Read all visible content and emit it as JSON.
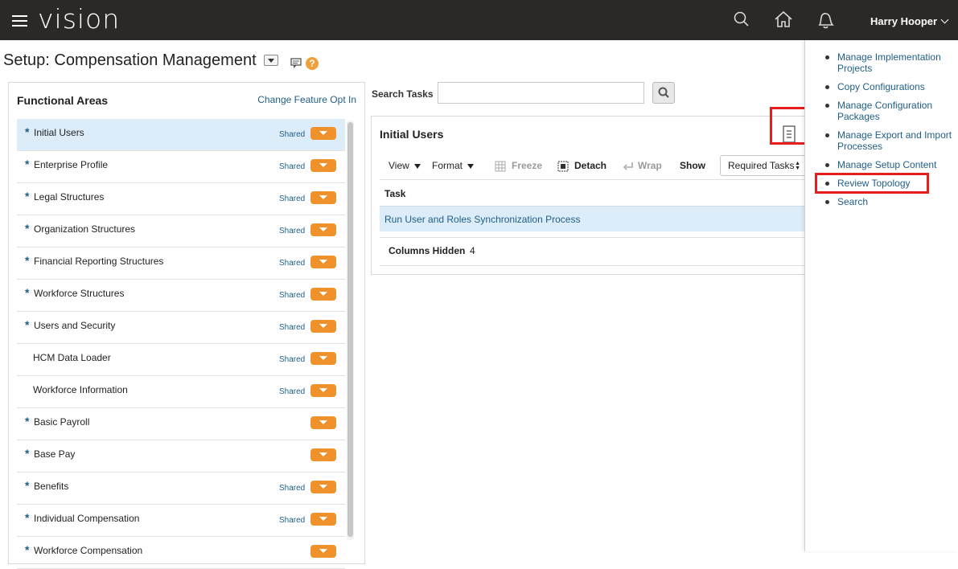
{
  "app": {
    "brand": "vision",
    "user_name": "Harry Hooper"
  },
  "page": {
    "title": "Setup: Compensation Management",
    "help_glyph": "?"
  },
  "functional_areas": {
    "title": "Functional Areas",
    "change_link": "Change Feature Opt In",
    "items": [
      {
        "label": "Initial Users",
        "required": "*",
        "shared": "Shared",
        "selected": true
      },
      {
        "label": "Enterprise Profile",
        "required": "*",
        "shared": "Shared"
      },
      {
        "label": "Legal Structures",
        "required": "*",
        "shared": "Shared"
      },
      {
        "label": "Organization Structures",
        "required": "*",
        "shared": "Shared"
      },
      {
        "label": "Financial Reporting Structures",
        "required": "*",
        "shared": "Shared"
      },
      {
        "label": "Workforce Structures",
        "required": "*",
        "shared": "Shared"
      },
      {
        "label": "Users and Security",
        "required": "*",
        "shared": "Shared"
      },
      {
        "label": "HCM Data Loader",
        "required": "",
        "shared": "Shared"
      },
      {
        "label": "Workforce Information",
        "required": "",
        "shared": "Shared"
      },
      {
        "label": "Basic Payroll",
        "required": "*",
        "shared": ""
      },
      {
        "label": "Base Pay",
        "required": "*",
        "shared": ""
      },
      {
        "label": "Benefits",
        "required": "*",
        "shared": "Shared"
      },
      {
        "label": "Individual Compensation",
        "required": "*",
        "shared": "Shared"
      },
      {
        "label": "Workforce Compensation",
        "required": "*",
        "shared": ""
      }
    ]
  },
  "search": {
    "label": "Search Tasks",
    "value": "",
    "placeholder": ""
  },
  "initial_users": {
    "title": "Initial Users",
    "toolbar": {
      "view": "View",
      "format": "Format",
      "freeze": "Freeze",
      "detach": "Detach",
      "wrap": "Wrap",
      "show": "Show",
      "show_value": "Required Tasks"
    },
    "table": {
      "header_task": "Task",
      "rows": [
        "Run User and Roles Synchronization Process"
      ],
      "columns_hidden_label": "Columns Hidden",
      "columns_hidden_value": "4"
    }
  },
  "right_panel": {
    "links": [
      "Manage Implementation Projects",
      "Copy Configurations",
      "Manage Configuration Packages",
      "Manage Export and Import Processes",
      "Manage Setup Content",
      "Review Topology",
      "Search"
    ]
  },
  "colors": {
    "topbar": "#2b2825",
    "link": "#1f5e86",
    "orange": "#f0922b",
    "selected_row": "#dcecf8",
    "highlight": "#e61e1e"
  }
}
